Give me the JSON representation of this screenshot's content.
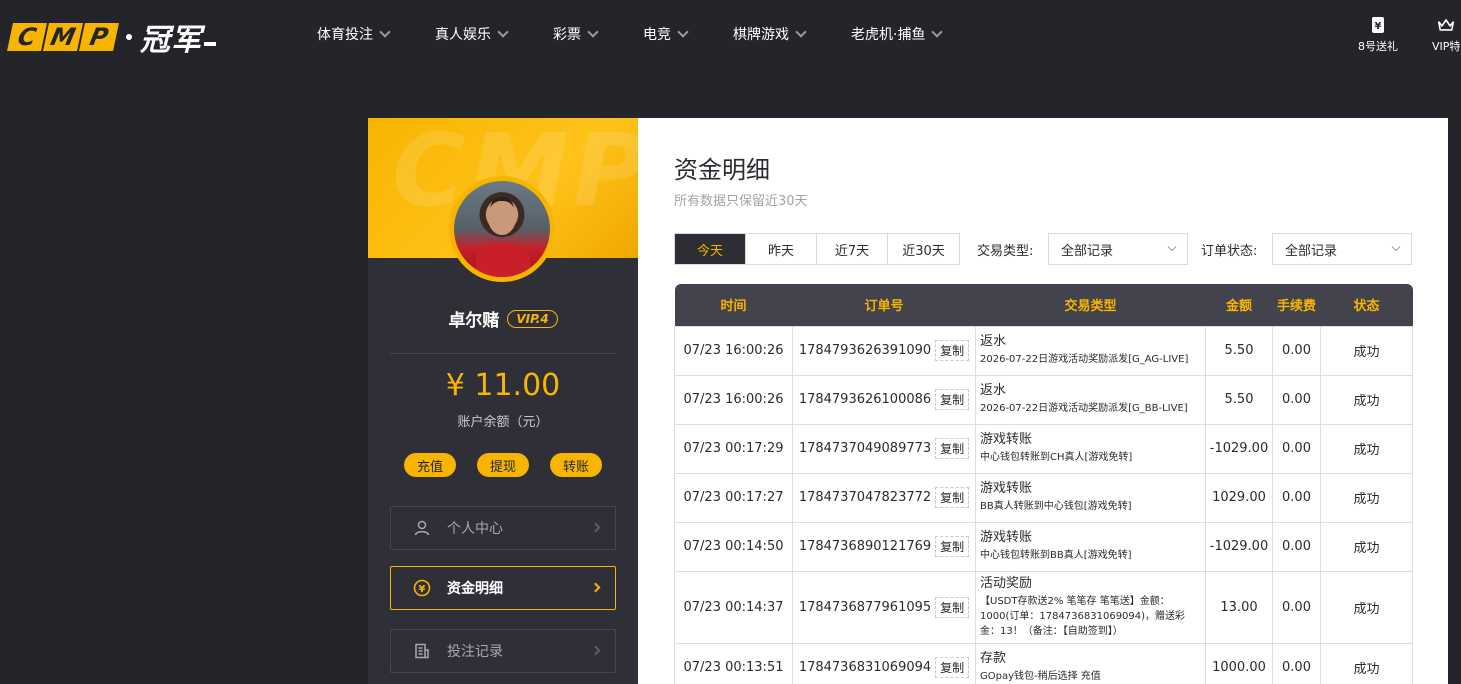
{
  "logo": {
    "letters": [
      "C",
      "M",
      "P"
    ],
    "cn": "冠军"
  },
  "nav": [
    {
      "label": "体育投注"
    },
    {
      "label": "真人娱乐"
    },
    {
      "label": "彩票"
    },
    {
      "label": "电竞"
    },
    {
      "label": "棋牌游戏"
    },
    {
      "label": "老虎机·捕鱼"
    }
  ],
  "top_right": [
    {
      "label": "8号送礼",
      "icon": "ticket-icon"
    },
    {
      "label": "VIP特",
      "icon": "crown-icon"
    }
  ],
  "profile": {
    "watermark": "CMP",
    "name": "卓尔赌",
    "vip": "VIP.4",
    "balance": "¥ 11.00",
    "balance_label": "账户余额（元）",
    "actions": [
      "充值",
      "提现",
      "转账"
    ],
    "menu": [
      {
        "label": "个人中心",
        "icon": "user-icon",
        "active": false
      },
      {
        "label": "资金明细",
        "icon": "yen-circle-icon",
        "active": true
      },
      {
        "label": "投注记录",
        "icon": "document-icon",
        "active": false
      }
    ]
  },
  "main": {
    "title": "资金明细",
    "subtitle": "所有数据只保留近30天",
    "ranges": [
      "今天",
      "昨天",
      "近7天",
      "近30天"
    ],
    "active_range": 0,
    "filter_type_label": "交易类型:",
    "filter_type_value": "全部记录",
    "filter_status_label": "订单状态:",
    "filter_status_value": "全部记录",
    "columns": [
      "时间",
      "订单号",
      "交易类型",
      "金额",
      "手续费",
      "状态"
    ],
    "copy_label": "复制",
    "rows": [
      {
        "time": "07/23 16:00:26",
        "order": "1784793626391090",
        "type": "返水",
        "detail": "2026-07-22日游戏活动奖励派发[G_AG-LIVE]",
        "amount": "5.50",
        "fee": "0.00",
        "status": "成功"
      },
      {
        "time": "07/23 16:00:26",
        "order": "1784793626100086",
        "type": "返水",
        "detail": "2026-07-22日游戏活动奖励派发[G_BB-LIVE]",
        "amount": "5.50",
        "fee": "0.00",
        "status": "成功"
      },
      {
        "time": "07/23 00:17:29",
        "order": "1784737049089773",
        "type": "游戏转账",
        "detail": "中心钱包转账到CH真人[游戏免转]",
        "amount": "-1029.00",
        "fee": "0.00",
        "status": "成功"
      },
      {
        "time": "07/23 00:17:27",
        "order": "1784737047823772",
        "type": "游戏转账",
        "detail": "BB真人转账到中心钱包[游戏免转]",
        "amount": "1029.00",
        "fee": "0.00",
        "status": "成功"
      },
      {
        "time": "07/23 00:14:50",
        "order": "1784736890121769",
        "type": "游戏转账",
        "detail": "中心钱包转账到BB真人[游戏免转]",
        "amount": "-1029.00",
        "fee": "0.00",
        "status": "成功"
      },
      {
        "time": "07/23 00:14:37",
        "order": "1784736877961095",
        "type": "活动奖励",
        "detail": "【USDT存款送2% 笔笔存 笔笔送】金额：1000(订单：1784736831069094)，赠送彩金：13！（备注：【自助签到】）",
        "amount": "13.00",
        "fee": "0.00",
        "status": "成功"
      },
      {
        "time": "07/23 00:13:51",
        "order": "1784736831069094",
        "type": "存款",
        "detail": "GOpay钱包-稍后选择 充值",
        "amount": "1000.00",
        "fee": "0.00",
        "status": "成功"
      }
    ]
  },
  "colors": {
    "accent": "#f7b500",
    "dark": "#24252b",
    "success": "#3c9a2b"
  }
}
